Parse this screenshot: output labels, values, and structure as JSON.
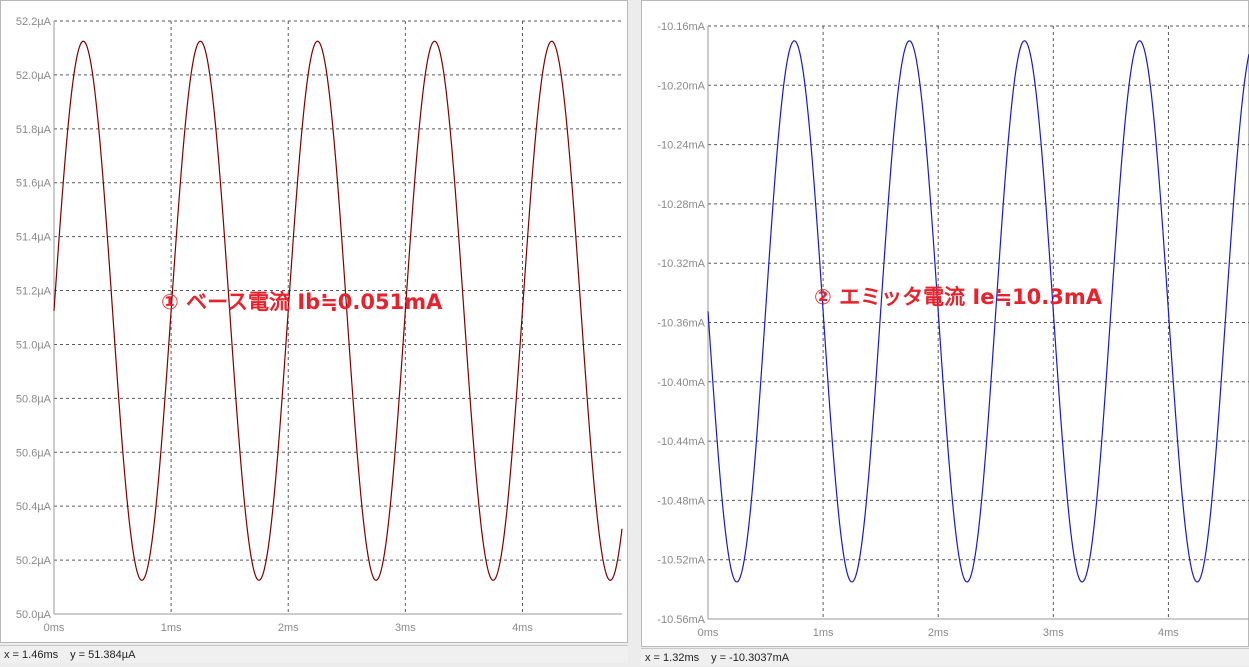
{
  "chart_data": [
    {
      "type": "line",
      "title": "",
      "xlabel": "",
      "ylabel": "",
      "xlim": [
        0,
        4.85
      ],
      "ylim": [
        50.0,
        52.2
      ],
      "x_tick_labels": [
        "0ms",
        "1ms",
        "2ms",
        "3ms",
        "4ms"
      ],
      "x_ticks": [
        0,
        1,
        2,
        3,
        4
      ],
      "y_tick_labels": [
        "52.2µA",
        "52.0µA",
        "51.8µA",
        "51.6µA",
        "51.4µA",
        "51.2µA",
        "51.0µA",
        "50.8µA",
        "50.6µA",
        "50.4µA",
        "50.2µA",
        "50.0µA"
      ],
      "y_ticks": [
        52.2,
        52.0,
        51.8,
        51.6,
        51.4,
        51.2,
        51.0,
        50.8,
        50.6,
        50.4,
        50.2,
        50.0
      ],
      "grid": true,
      "series": [
        {
          "color": "#800000",
          "offset": 51.125,
          "amplitude": 1.0,
          "frequency_khz": 1.0,
          "phase_ms": 0.0,
          "invert": false
        }
      ],
      "annotation": "① ベース電流 Ib≒0.051mA",
      "cursor": {
        "x_readout": "x = 1.46ms",
        "y_readout": "y = 51.384µA"
      }
    },
    {
      "type": "line",
      "title": "",
      "xlabel": "",
      "ylabel": "",
      "xlim": [
        0,
        4.7
      ],
      "ylim": [
        -10.56,
        -10.16
      ],
      "x_tick_labels": [
        "0ms",
        "1ms",
        "2ms",
        "3ms",
        "4ms"
      ],
      "x_ticks": [
        0,
        1,
        2,
        3,
        4
      ],
      "y_tick_labels": [
        "-10.16mA",
        "-10.20mA",
        "-10.24mA",
        "-10.28mA",
        "-10.32mA",
        "-10.36mA",
        "-10.40mA",
        "-10.44mA",
        "-10.48mA",
        "-10.52mA",
        "-10.56mA"
      ],
      "y_ticks": [
        -10.16,
        -10.2,
        -10.24,
        -10.28,
        -10.32,
        -10.36,
        -10.4,
        -10.44,
        -10.48,
        -10.52,
        -10.56
      ],
      "grid": true,
      "series": [
        {
          "color": "#1a1acc",
          "offset": -10.3525,
          "amplitude": 0.1825,
          "frequency_khz": 1.0,
          "phase_ms": 0.0,
          "invert": true
        }
      ],
      "annotation": "② エミッタ電流 Ie≒10.3mA",
      "cursor": {
        "x_readout": "x = 1.32ms",
        "y_readout": "y = -10.3037mA"
      }
    }
  ]
}
